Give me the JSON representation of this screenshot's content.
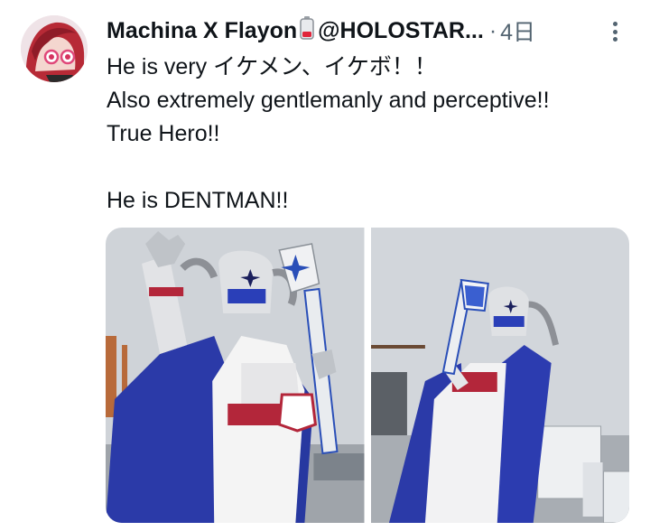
{
  "tweet": {
    "author_name": "Machina X Flayon",
    "handle": "@HOLOSTAR...",
    "separator": "·",
    "time": "4日",
    "name_emoji_icon": "battery-low-icon",
    "more_icon": "more-vertical-icon",
    "text_lines": [
      "He is very イケメン、イケボ！！",
      "Also extremely gentlemanly and perceptive!!",
      "True Hero!!",
      "",
      "He is DENTMAN!!"
    ],
    "media": [
      {
        "label": "photo-1"
      },
      {
        "label": "photo-2"
      }
    ]
  },
  "colors": {
    "text_primary": "#0f1419",
    "text_secondary": "#536471",
    "cape_blue": "#2b3aa8",
    "belt_red": "#b3263a",
    "sky": "#cfd3d8"
  }
}
